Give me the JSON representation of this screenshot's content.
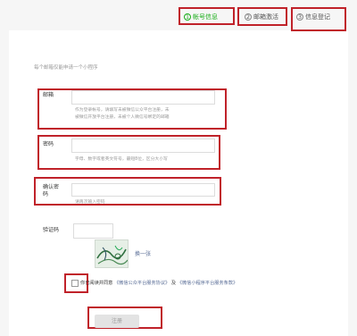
{
  "steps": [
    {
      "num": "1",
      "label": "帐号信息"
    },
    {
      "num": "2",
      "label": "邮箱激活"
    },
    {
      "num": "3",
      "label": "信息登记"
    }
  ],
  "intro": "每个邮箱仅能申请一个小程序",
  "form": {
    "email_label": "邮箱",
    "email_hint_1": "作为登录帐号，请填写未被微信公众平台注册，未",
    "email_hint_2": "被微信开放平台注册，未被个人微信号绑定的邮箱",
    "password_label": "密码",
    "password_hint": "字母、数字或者英文符号，最短8位，区分大小写",
    "confirm_label_1": "确认密",
    "confirm_label_2": "码",
    "confirm_hint": "请再次输入密码",
    "captcha_label": "验证码",
    "captcha_refresh": "换一张",
    "agree_prefix": "你已阅读并同意",
    "agree_link_1": "《微信公众平台服务协议》",
    "agree_and": "及",
    "agree_link_2": "《微信小程序平台服务条款》",
    "submit_label": "注册"
  },
  "colors": {
    "accent": "#1aad19",
    "highlight": "#c0222a"
  }
}
